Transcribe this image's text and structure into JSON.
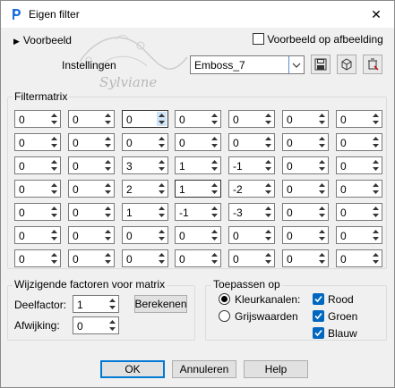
{
  "window": {
    "title": "Eigen filter",
    "close_glyph": "✕"
  },
  "preview": {
    "toggle_label": "Voorbeeld",
    "on_image_label": "Voorbeeld op afbeelding",
    "on_image_checked": false
  },
  "watermark": {
    "text": "Sylviane"
  },
  "settings": {
    "label": "Instellingen",
    "preset_value": "Emboss_7",
    "buttons": [
      "save-icon",
      "reset-icon",
      "delete-icon"
    ]
  },
  "matrix": {
    "title": "Filtermatrix",
    "rows": [
      [
        "0",
        "0",
        "0",
        "0",
        "0",
        "0",
        "0"
      ],
      [
        "0",
        "0",
        "0",
        "0",
        "0",
        "0",
        "0"
      ],
      [
        "0",
        "0",
        "3",
        "1",
        "-1",
        "0",
        "0"
      ],
      [
        "0",
        "0",
        "2",
        "1",
        "-2",
        "0",
        "0"
      ],
      [
        "0",
        "0",
        "1",
        "-1",
        "-3",
        "0",
        "0"
      ],
      [
        "0",
        "0",
        "0",
        "0",
        "0",
        "0",
        "0"
      ],
      [
        "0",
        "0",
        "0",
        "0",
        "0",
        "0",
        "0"
      ]
    ]
  },
  "factors": {
    "title": "Wijzigende factoren voor matrix",
    "divisor_label": "Deelfactor:",
    "divisor_value": "1",
    "bias_label": "Afwijking:",
    "bias_value": "0",
    "compute_label": "Berekenen"
  },
  "apply": {
    "title": "Toepassen op",
    "color_channels_label": "Kleurkanalen:",
    "grayscale_label": "Grijswaarden",
    "selected": "Kleurkanalen",
    "red_label": "Rood",
    "green_label": "Groen",
    "blue_label": "Blauw"
  },
  "footer": {
    "ok_label": "OK",
    "cancel_label": "Annuleren",
    "help_label": "Help"
  }
}
